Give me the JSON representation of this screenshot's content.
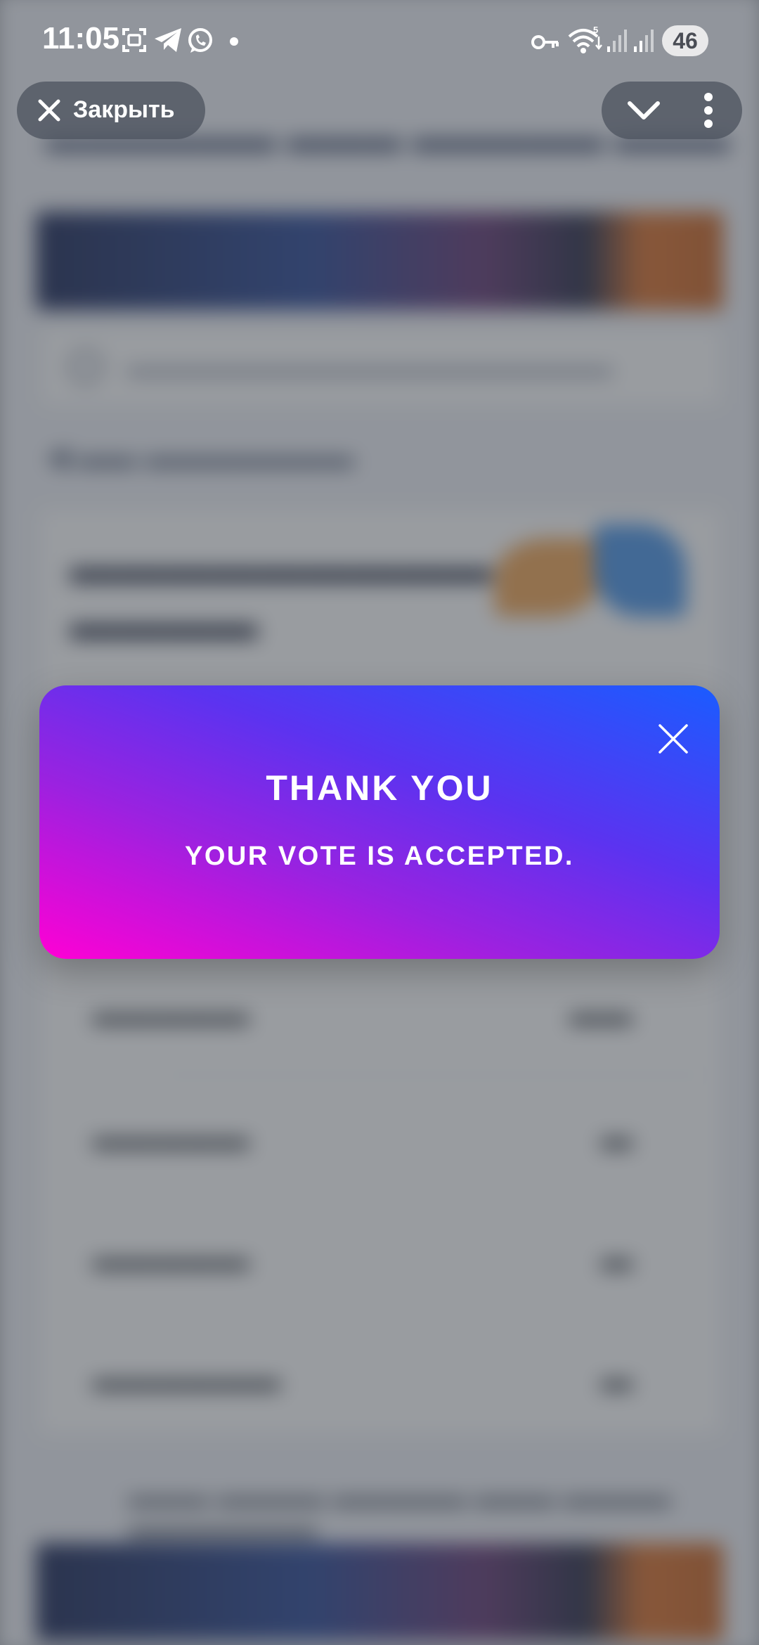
{
  "status_bar": {
    "time": "11:05",
    "battery": "46",
    "icons": [
      "screenshot-icon",
      "telegram-icon",
      "whatsapp-icon",
      "notification-dot-icon",
      "vpn-key-icon",
      "wifi-icon",
      "signal-icon",
      "signal-icon"
    ]
  },
  "browser": {
    "close_label": "Закрыть",
    "close_icon": "close-icon",
    "collapse_icon": "chevron-down-icon",
    "more_icon": "more-vertical-icon"
  },
  "modal": {
    "title": "THANK YOU",
    "message": "YOUR VOTE IS ACCEPTED.",
    "close_icon": "close-icon",
    "gradient_colors": [
      "#ff00d4",
      "#9a22e0",
      "#5b33f0",
      "#1a5cff"
    ]
  }
}
